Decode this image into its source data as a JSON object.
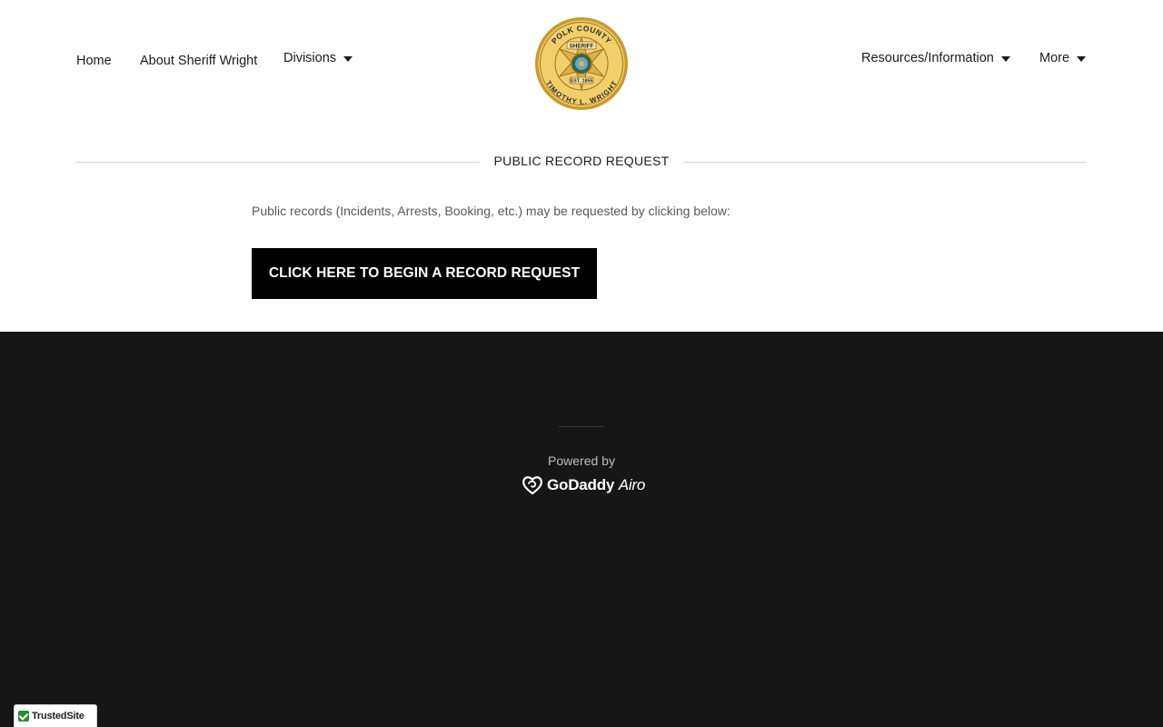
{
  "nav": {
    "home": "Home",
    "about": "About Sheriff Wright",
    "divisions": "Divisions",
    "resources": "Resources/Information",
    "more": "More"
  },
  "logo": {
    "top_text": "POLK COUNTY",
    "banner_text": "SHERIFF",
    "est_text": "EST. 1855",
    "bottom_text": "TIMOTHY L. WRIGHT",
    "gold": "#c99a2e",
    "gold_light": "#f2cf6b"
  },
  "section": {
    "title": "PUBLIC RECORD REQUEST",
    "description": "Public records (Incidents, Arrests, Booking, etc.)  may be requested by clicking below:",
    "cta_label": "CLICK HERE TO BEGIN A RECORD REQUEST"
  },
  "footer": {
    "powered_by": "Powered by",
    "brand": "GoDaddy",
    "brand_suffix": "Airo"
  },
  "badge": {
    "label": "TrustedSite",
    "icon": "check-icon",
    "accent": "#2e8b2e"
  },
  "colors": {
    "footer_bg": "#161616",
    "button_bg": "#000000",
    "text_muted": "#595959"
  }
}
